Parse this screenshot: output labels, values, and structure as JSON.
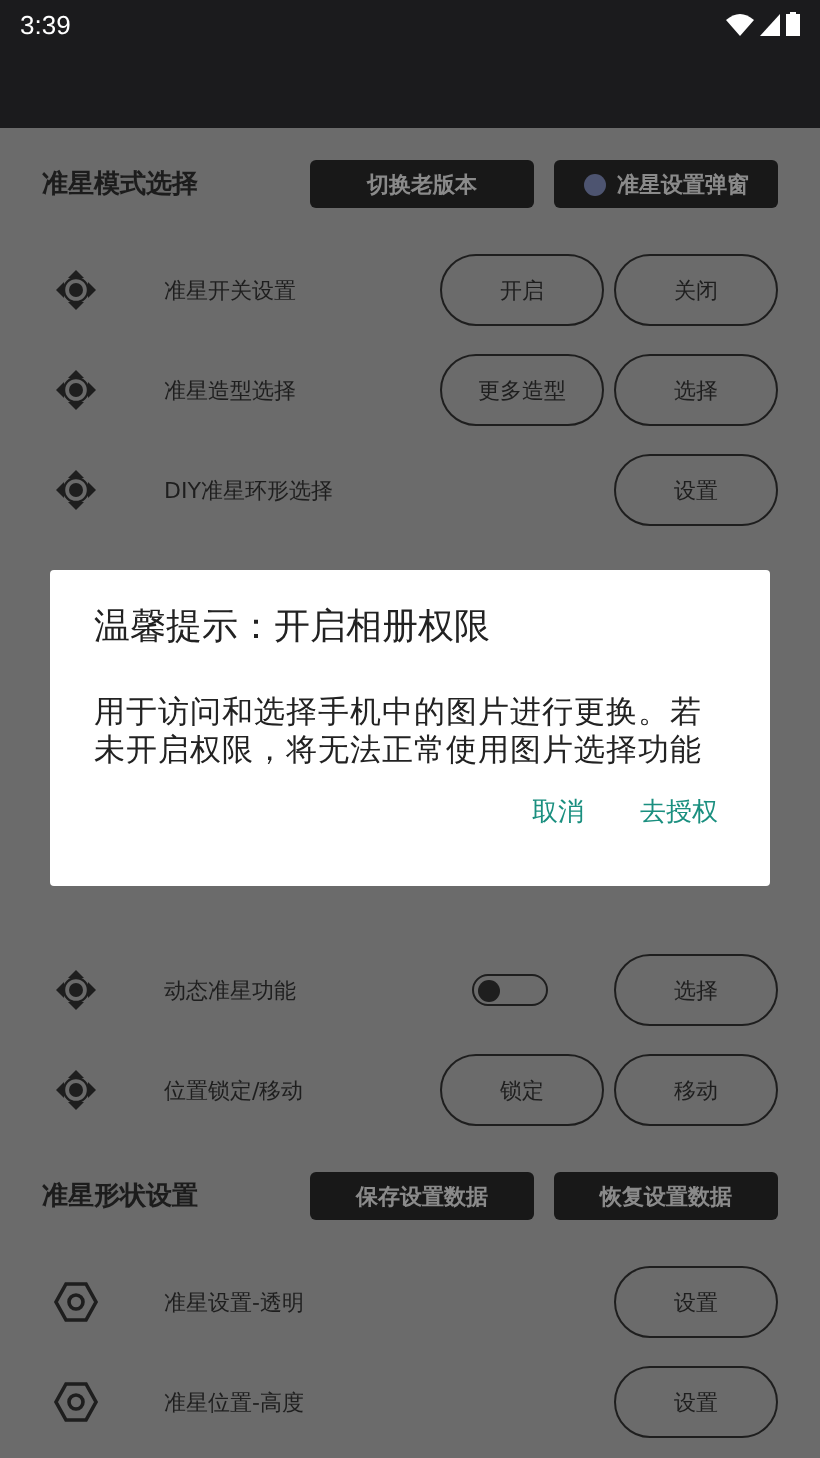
{
  "status_bar": {
    "time": "3:39"
  },
  "section_1": {
    "title": "准星模式选择",
    "buttons": [
      {
        "label": "切换老版本",
        "kind": "plain"
      },
      {
        "label": "准星设置弹窗",
        "kind": "radio",
        "checked": false
      }
    ]
  },
  "rows_top": [
    {
      "label": "准星开关设置",
      "buttons": [
        "开启",
        "关闭"
      ]
    },
    {
      "label": "准星造型选择",
      "buttons": [
        "更多造型",
        "选择"
      ]
    },
    {
      "label": "DIY准星环形选择",
      "buttons": [
        "设置"
      ]
    }
  ],
  "rows_bottom": [
    {
      "label": "动态准星功能",
      "toggle": {
        "on": false
      },
      "buttons": [
        "选择"
      ]
    },
    {
      "label": "位置锁定/移动",
      "buttons": [
        "锁定",
        "移动"
      ]
    }
  ],
  "section_2": {
    "title": "准星形状设置",
    "buttons": [
      {
        "label": "保存设置数据",
        "kind": "plain"
      },
      {
        "label": "恢复设置数据",
        "kind": "plain"
      }
    ]
  },
  "rows_shape": [
    {
      "label": "准星设置-透明",
      "buttons": [
        "设置"
      ]
    },
    {
      "label": "准星位置-高度",
      "buttons": [
        "设置"
      ]
    }
  ],
  "dialog": {
    "title": "温馨提示：开启相册权限",
    "message": "用于访问和选择手机中的图片进行更换。若未开启权限，将无法正常使用图片选择功能",
    "actions": [
      "取消",
      "去授权"
    ]
  }
}
